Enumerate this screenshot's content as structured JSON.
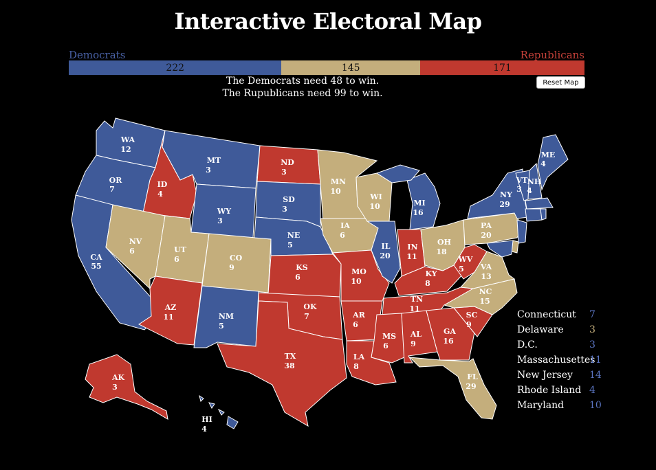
{
  "title": "Interactive Electoral Map",
  "colors": {
    "dem": "#3F5A99",
    "rep": "#C0392F",
    "tossup": "#C4AE7C",
    "dem_label": "#4A63A8",
    "rep_label": "#C9423A"
  },
  "tally": {
    "dem_label": "Democrats",
    "rep_label": "Republicans",
    "dem": "222",
    "tossup": "145",
    "rep": "171",
    "dem_need": "The Democrats need 48 to win.",
    "rep_need": "The Rupublicans need 99 to win."
  },
  "reset_label": "Reset Map",
  "states": {
    "WA": {
      "abbr": "WA",
      "ev": "12",
      "party": "dem"
    },
    "OR": {
      "abbr": "OR",
      "ev": "7",
      "party": "dem"
    },
    "CA": {
      "abbr": "CA",
      "ev": "55",
      "party": "dem"
    },
    "ID": {
      "abbr": "ID",
      "ev": "4",
      "party": "rep"
    },
    "NV": {
      "abbr": "NV",
      "ev": "6",
      "party": "tossup"
    },
    "MT": {
      "abbr": "MT",
      "ev": "3",
      "party": "dem"
    },
    "WY": {
      "abbr": "WY",
      "ev": "3",
      "party": "dem"
    },
    "UT": {
      "abbr": "UT",
      "ev": "6",
      "party": "tossup"
    },
    "AZ": {
      "abbr": "AZ",
      "ev": "11",
      "party": "rep"
    },
    "CO": {
      "abbr": "CO",
      "ev": "9",
      "party": "tossup"
    },
    "NM": {
      "abbr": "NM",
      "ev": "5",
      "party": "dem"
    },
    "ND": {
      "abbr": "ND",
      "ev": "3",
      "party": "rep"
    },
    "SD": {
      "abbr": "SD",
      "ev": "3",
      "party": "dem"
    },
    "NE": {
      "abbr": "NE",
      "ev": "5",
      "party": "dem"
    },
    "KS": {
      "abbr": "KS",
      "ev": "6",
      "party": "rep"
    },
    "OK": {
      "abbr": "OK",
      "ev": "7",
      "party": "rep"
    },
    "TX": {
      "abbr": "TX",
      "ev": "38",
      "party": "rep"
    },
    "MN": {
      "abbr": "MN",
      "ev": "10",
      "party": "tossup"
    },
    "IA": {
      "abbr": "IA",
      "ev": "6",
      "party": "tossup"
    },
    "MO": {
      "abbr": "MO",
      "ev": "10",
      "party": "rep"
    },
    "AR": {
      "abbr": "AR",
      "ev": "6",
      "party": "rep"
    },
    "LA": {
      "abbr": "LA",
      "ev": "8",
      "party": "rep"
    },
    "WI": {
      "abbr": "WI",
      "ev": "10",
      "party": "tossup"
    },
    "IL": {
      "abbr": "IL",
      "ev": "20",
      "party": "dem"
    },
    "MI": {
      "abbr": "MI",
      "ev": "16",
      "party": "dem"
    },
    "IN": {
      "abbr": "IN",
      "ev": "11",
      "party": "rep"
    },
    "OH": {
      "abbr": "OH",
      "ev": "18",
      "party": "tossup"
    },
    "KY": {
      "abbr": "KY",
      "ev": "8",
      "party": "rep"
    },
    "TN": {
      "abbr": "TN",
      "ev": "11",
      "party": "rep"
    },
    "MS": {
      "abbr": "MS",
      "ev": "6",
      "party": "rep"
    },
    "AL": {
      "abbr": "AL",
      "ev": "9",
      "party": "rep"
    },
    "GA": {
      "abbr": "GA",
      "ev": "16",
      "party": "rep"
    },
    "FL": {
      "abbr": "FL",
      "ev": "29",
      "party": "tossup"
    },
    "SC": {
      "abbr": "SC",
      "ev": "9",
      "party": "rep"
    },
    "NC": {
      "abbr": "NC",
      "ev": "15",
      "party": "tossup"
    },
    "VA": {
      "abbr": "VA",
      "ev": "13",
      "party": "tossup"
    },
    "WV": {
      "abbr": "WV",
      "ev": "5",
      "party": "rep"
    },
    "PA": {
      "abbr": "PA",
      "ev": "20",
      "party": "tossup"
    },
    "NY": {
      "abbr": "NY",
      "ev": "29",
      "party": "dem"
    },
    "VT": {
      "abbr": "VT",
      "ev": "3",
      "party": "dem"
    },
    "NH": {
      "abbr": "NH",
      "ev": "4",
      "party": "dem"
    },
    "ME": {
      "abbr": "ME",
      "ev": "4",
      "party": "dem"
    },
    "AK": {
      "abbr": "AK",
      "ev": "3",
      "party": "rep"
    },
    "HI": {
      "abbr": "HI",
      "ev": "4",
      "party": "dem"
    }
  },
  "small_states": [
    {
      "name": "Connecticut",
      "ev": "7",
      "party": "dem"
    },
    {
      "name": "Delaware",
      "ev": "3",
      "party": "tossup"
    },
    {
      "name": "D.C.",
      "ev": "3",
      "party": "dem"
    },
    {
      "name": "Massachusettes",
      "ev": "11",
      "party": "dem"
    },
    {
      "name": "New Jersey",
      "ev": "14",
      "party": "dem"
    },
    {
      "name": "Rhode Island",
      "ev": "4",
      "party": "dem"
    },
    {
      "name": "Maryland",
      "ev": "10",
      "party": "dem"
    }
  ]
}
